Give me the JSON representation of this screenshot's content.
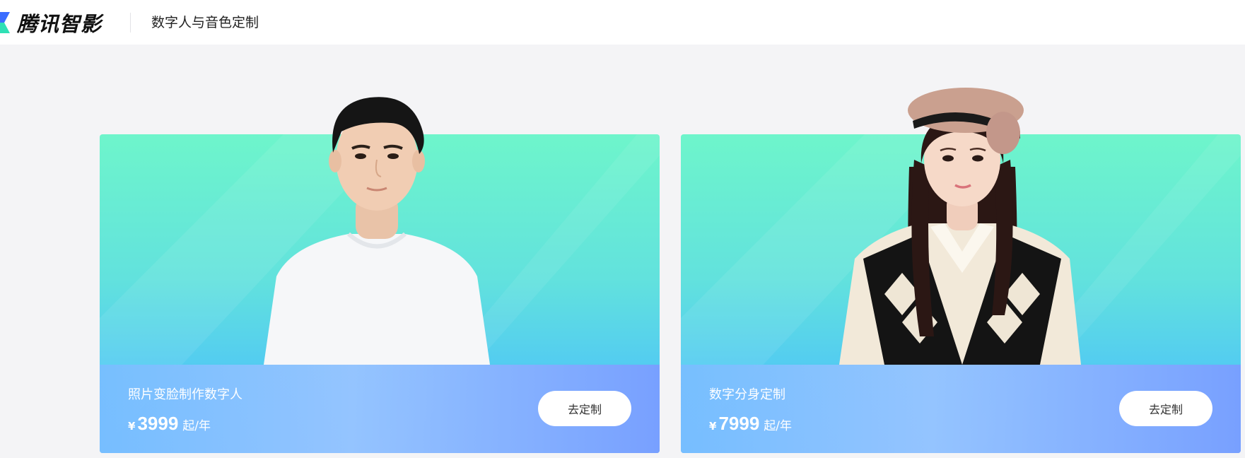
{
  "header": {
    "logo_text": "腾讯智影",
    "page_title": "数字人与音色定制",
    "brand_colors": [
      "#2fe0b5",
      "#3b6cff"
    ]
  },
  "cards": [
    {
      "name": "照片变脸制作数字人",
      "currency": "¥",
      "price": "3999",
      "unit": "起/年",
      "button_label": "去定制"
    },
    {
      "name": "数字分身定制",
      "currency": "¥",
      "price": "7999",
      "unit": "起/年",
      "button_label": "去定制"
    }
  ],
  "colors": {
    "page_bg": "#f4f4f6",
    "card_gradient_top": "#6ef5cb",
    "card_gradient_bottom": "#52b7ff",
    "info_bar": "#96c4ff"
  }
}
